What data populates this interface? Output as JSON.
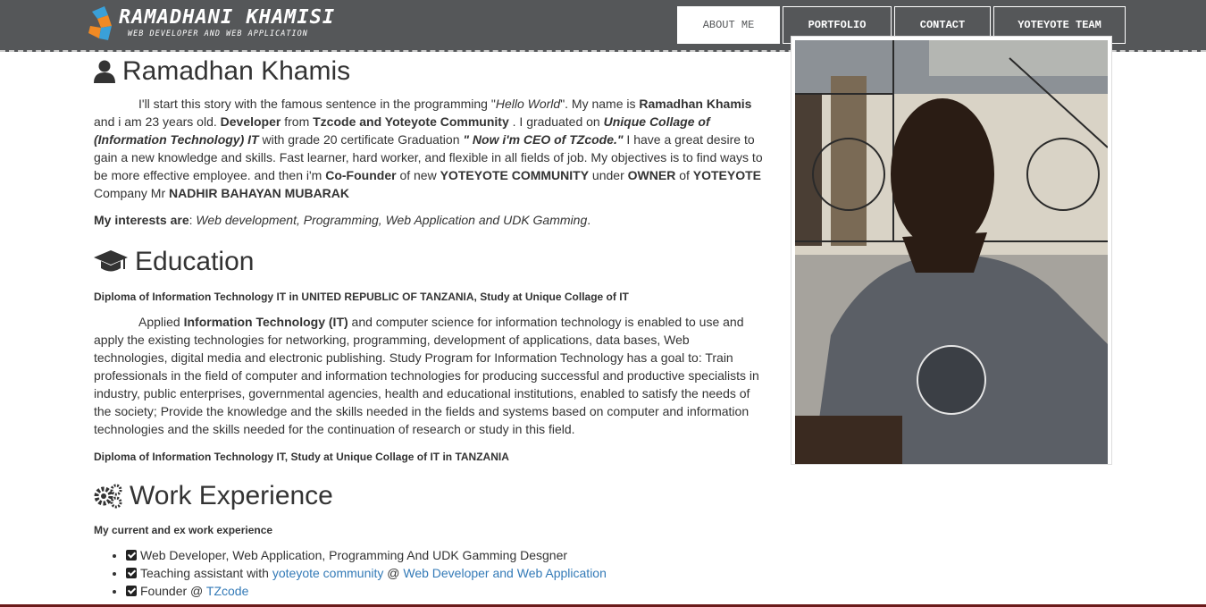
{
  "brand": {
    "title": "RAMADHANI KHAMISI",
    "subtitle": "WEB DEVELOPER AND WEB APPLICATION"
  },
  "nav": [
    {
      "label": "ABOUT ME",
      "active": true
    },
    {
      "label": "PORTFOLIO",
      "active": false
    },
    {
      "label": "CONTACT",
      "active": false
    },
    {
      "label": "YOTEYOTE TEAM",
      "active": false
    }
  ],
  "about": {
    "heading": "Ramadhan Khamis",
    "icon": "user-icon",
    "p1": {
      "t1": "I'll start this story with the famous sentence in the programming \"",
      "t2": "Hello World",
      "t3": "\". My name is ",
      "t4": "Ramadhan Khamis",
      "t5": " and i am 23 years old. ",
      "t6": "Developer",
      "t7": " from ",
      "t8": "Tzcode and Yoteyote Community",
      "t9": " . I graduated on ",
      "t10": "Unique Collage of (Information Technology) IT",
      "t11": " with grade 20 certificate Graduation ",
      "t12": "\" Now i'm CEO of TZcode.\"",
      "t13": " I have a great desire to gain a new knowledge and skills. Fast learner, hard worker, and flexible in all fields of job. My objectives is to find ways to be more effective employee. and then i'm ",
      "t14": "Co-Founder",
      "t15": " of new ",
      "t16": "YOTEYOTE COMMUNITY",
      "t17": " under ",
      "t18": "OWNER",
      "t19": " of ",
      "t20": "YOTEYOTE",
      "t21": " Company Mr ",
      "t22": "NADHIR BAHAYAN MUBARAK"
    },
    "interests_label": "My interests are",
    "interests_colon": ": ",
    "interests_value": "Web development, Programming, Web Application and UDK Gamming",
    "interests_end": "."
  },
  "education": {
    "heading": "Education",
    "icon": "graduation-cap-icon",
    "sub1": "Diploma of Information Technology IT in UNITED REPUBLIC OF TANZANIA, Study at Unique Collage of IT",
    "p_t1": "Applied ",
    "p_t2": "Information Technology (IT)",
    "p_t3": " and computer science for information technology is enabled to use and apply the existing technologies for networking, programming, development of applications, data bases, Web technologies, digital media and electronic publishing. Study Program for Information Technology has a goal to: Train professionals in the field of computer and information technologies for producing successful and productive specialists in industry, public enterprises, governmental agencies, health and educational institutions, enabled to satisfy the needs of the society; Provide the knowledge and the skills needed in the fields and systems based on computer and information technologies and the skills needed for the continuation of research or study in this field.",
    "sub2": "Diploma of Information Technology IT, Study at Unique Collage of IT in TANZANIA"
  },
  "work": {
    "heading": "Work Experience",
    "icon": "gears-icon",
    "sub": "My current and ex work experience",
    "items": [
      {
        "text": "Web Developer, Web Application, Programming And UDK Gamming Desgner"
      },
      {
        "text": "Teaching assistant with ",
        "link1": "yoteyote community",
        "mid": " @ ",
        "link2": "Web Developer and Web Application"
      },
      {
        "text": "Founder @ ",
        "link1": "TZcode"
      }
    ]
  },
  "colors": {
    "navbar": "#555759",
    "link": "#337ab7",
    "text": "#333333"
  }
}
